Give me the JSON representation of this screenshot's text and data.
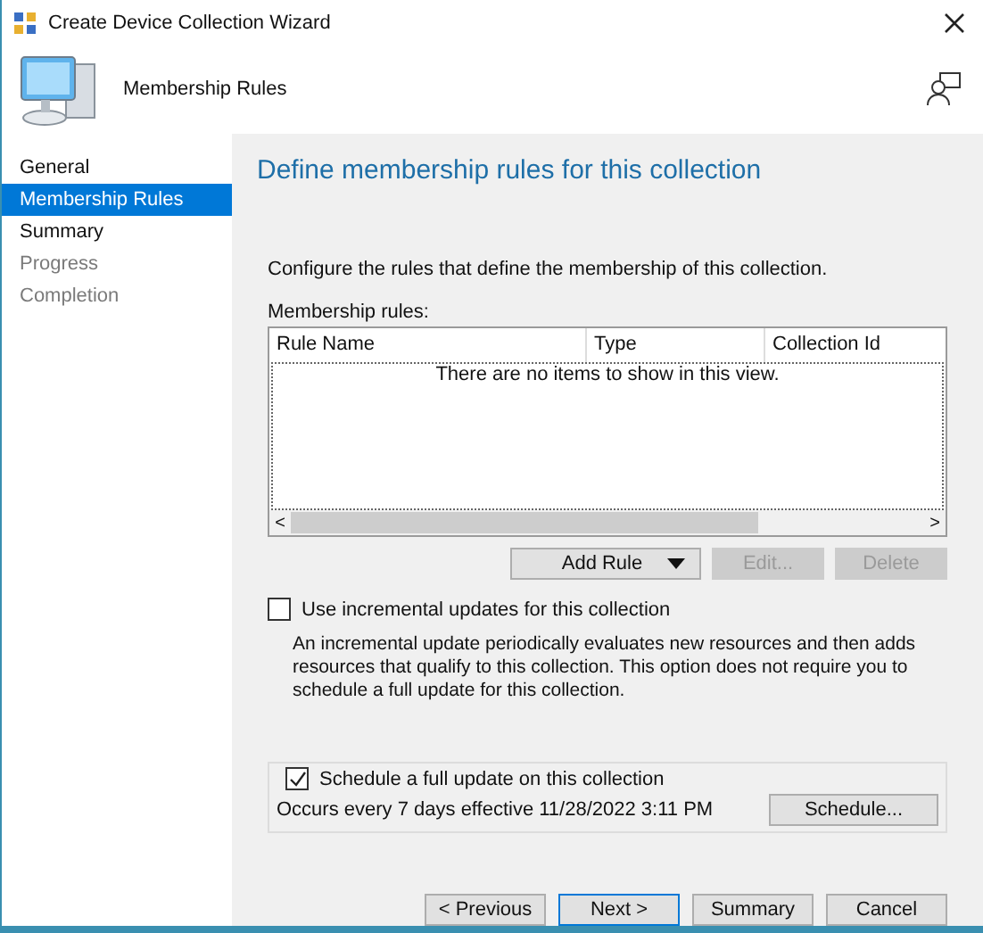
{
  "window": {
    "title": "Create Device Collection Wizard"
  },
  "header": {
    "title": "Membership Rules"
  },
  "steps": [
    {
      "label": "General",
      "selected": false,
      "disabled": false
    },
    {
      "label": "Membership Rules",
      "selected": true,
      "disabled": false
    },
    {
      "label": "Summary",
      "selected": false,
      "disabled": false
    },
    {
      "label": "Progress",
      "selected": false,
      "disabled": true
    },
    {
      "label": "Completion",
      "selected": false,
      "disabled": true
    }
  ],
  "page": {
    "heading": "Define membership rules for this collection",
    "description": "Configure the rules that define the membership of this collection.",
    "list_label": "Membership rules:"
  },
  "table": {
    "columns": [
      "Rule Name",
      "Type",
      "Collection Id"
    ],
    "empty_text": "There are no items to show in this view.",
    "scroll_left": "<",
    "scroll_right": ">"
  },
  "rule_buttons": [
    {
      "label": "Add Rule",
      "kind": "dropdown",
      "disabled": false
    },
    {
      "label": "Edit...",
      "kind": "plain",
      "disabled": true
    },
    {
      "label": "Delete",
      "kind": "plain",
      "disabled": true
    }
  ],
  "incremental": {
    "label": "Use incremental updates for this collection",
    "checked": false,
    "note": "An incremental update periodically evaluates new resources and then adds resources that qualify to this collection. This option does not require you to schedule a full update for this collection."
  },
  "full_update": {
    "label": "Schedule a full update on this collection",
    "checked": true,
    "schedule_text": "Occurs every 7 days effective 11/28/2022 3:11 PM",
    "button": "Schedule..."
  },
  "nav_buttons": [
    {
      "label": "< Previous",
      "default": false
    },
    {
      "label": "Next >",
      "default": true
    },
    {
      "label": "Summary",
      "default": false
    },
    {
      "label": "Cancel",
      "default": false
    }
  ]
}
